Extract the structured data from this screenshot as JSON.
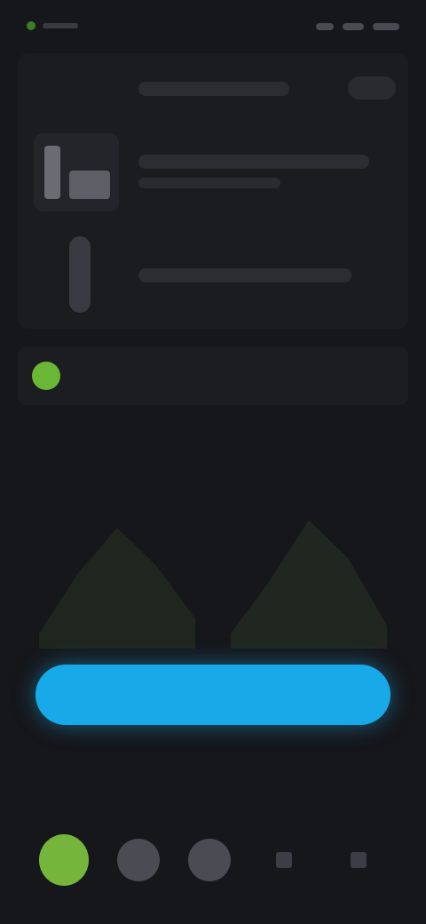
{
  "colors": {
    "background": "#16171b",
    "card": "#1b1c20",
    "accent_green": "#6ab735",
    "accent_blue": "#17a9e8"
  },
  "header_card": {
    "rows": [
      {
        "title": "",
        "subtitle": ""
      },
      {
        "title": "",
        "subtitle": ""
      },
      {
        "title": "",
        "subtitle": ""
      }
    ]
  },
  "notice": {
    "text": ""
  },
  "section": {
    "title": "",
    "link": ""
  },
  "chart_data": {
    "type": "area",
    "series": [
      {
        "values": [
          0.1,
          0.5,
          0.8,
          0.55,
          0.2
        ]
      },
      {
        "values": [
          0.1,
          0.45,
          0.85,
          0.6,
          0.15
        ]
      }
    ]
  },
  "cta": {
    "label": ""
  },
  "bottom_nav": {
    "items": [
      {
        "label": "",
        "icon": "home-icon",
        "active": true
      },
      {
        "label": "",
        "icon": "stats-icon",
        "active": false
      },
      {
        "label": "",
        "icon": "profile-icon",
        "active": false
      },
      {
        "label": "",
        "icon": "menu-icon",
        "active": false
      },
      {
        "label": "",
        "icon": "settings-icon",
        "active": false
      }
    ]
  }
}
